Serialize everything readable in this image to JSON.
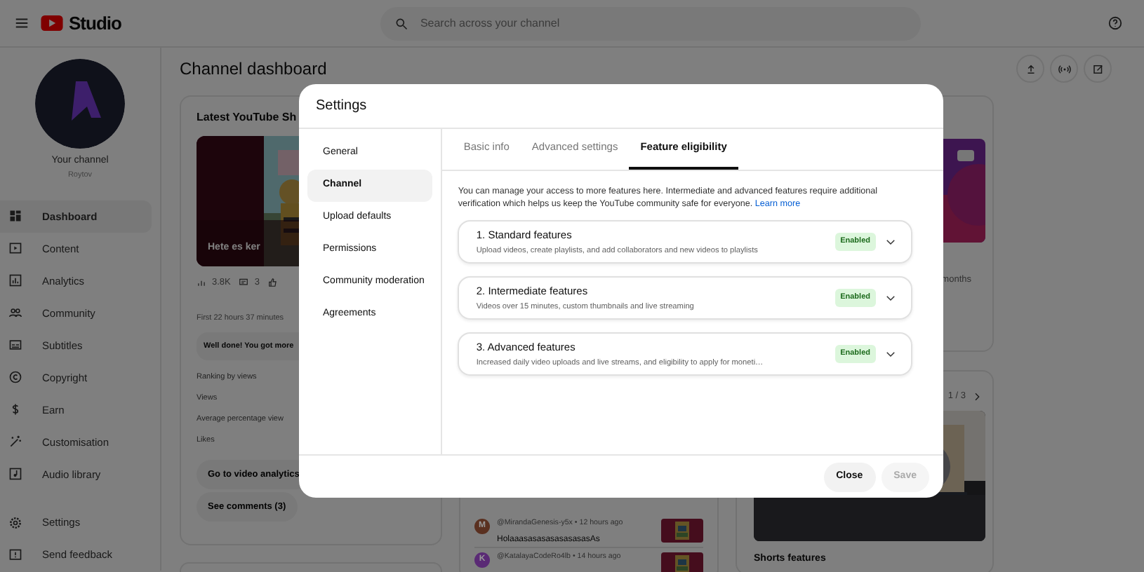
{
  "topbar": {
    "logo": "Studio",
    "search": {
      "placeholder": "Search across your channel"
    }
  },
  "sidebar": {
    "channel_label": "Your channel",
    "channel_name": "Roytov",
    "items": [
      {
        "label": "Dashboard",
        "selected": true
      },
      {
        "label": "Content",
        "selected": false
      },
      {
        "label": "Analytics",
        "selected": false
      },
      {
        "label": "Community",
        "selected": false
      },
      {
        "label": "Subtitles",
        "selected": false
      },
      {
        "label": "Copyright",
        "selected": false
      },
      {
        "label": "Earn",
        "selected": false
      },
      {
        "label": "Customisation",
        "selected": false
      },
      {
        "label": "Audio library",
        "selected": false
      }
    ],
    "footer_items": [
      {
        "label": "Settings"
      },
      {
        "label": "Send feedback"
      }
    ]
  },
  "dashboard": {
    "title": "Channel dashboard",
    "latest_short": {
      "title": "Latest YouTube Sh",
      "video_title": "Hete es ker",
      "stats": [
        "3.8K",
        "3"
      ],
      "period": "First 22 hours 37 minutes",
      "message": "Well done! You got more",
      "metrics": [
        "Ranking by views",
        "Views",
        "Average percentage view",
        "Likes"
      ],
      "buttons": [
        "Go to video analytics",
        "See comments (3)"
      ]
    },
    "comments": [
      {
        "initial": "M",
        "meta": "@MirandaGenesis-y5x • 12 hours ago",
        "text": "HolaaasasasasasasasasAs",
        "color": "#5a3020"
      },
      {
        "initial": "K",
        "meta": "@KatalayaCodeRo4lb • 14 hours ago",
        "color": "#5a2a75"
      }
    ],
    "right_card": {
      "text": "months"
    },
    "news_card": {
      "pager": "1 / 3",
      "caption": "Shorts features"
    }
  },
  "settings_dialog": {
    "title": "Settings",
    "nav": [
      {
        "label": "General",
        "selected": false
      },
      {
        "label": "Channel",
        "selected": true
      },
      {
        "label": "Upload defaults",
        "selected": false
      },
      {
        "label": "Permissions",
        "selected": false
      },
      {
        "label": "Community moderation",
        "selected": false
      },
      {
        "label": "Agreements",
        "selected": false
      }
    ],
    "tabs": [
      {
        "label": "Basic info",
        "selected": false
      },
      {
        "label": "Advanced settings",
        "selected": false
      },
      {
        "label": "Feature eligibility",
        "selected": true
      }
    ],
    "intro": "You can manage your access to more features here. Intermediate and advanced features require additional verification which helps us keep the YouTube community safe for everyone.",
    "learn_more": "Learn more",
    "features": [
      {
        "title": "1. Standard features",
        "description": "Upload videos, create playlists, and add collaborators and new videos to playlists",
        "status": "Enabled",
        "expanded": false
      },
      {
        "title": "2. Intermediate features",
        "description": "Videos over 15 minutes, custom thumbnails and live streaming",
        "status": "Enabled",
        "expanded": false
      },
      {
        "title": "3. Advanced features",
        "description": "Increased daily video uploads and live streams, and eligibility to apply for moneti…",
        "status": "Enabled",
        "expanded": false
      }
    ],
    "buttons": [
      {
        "label": "Close",
        "disabled": false
      },
      {
        "label": "Save",
        "disabled": true
      }
    ]
  }
}
